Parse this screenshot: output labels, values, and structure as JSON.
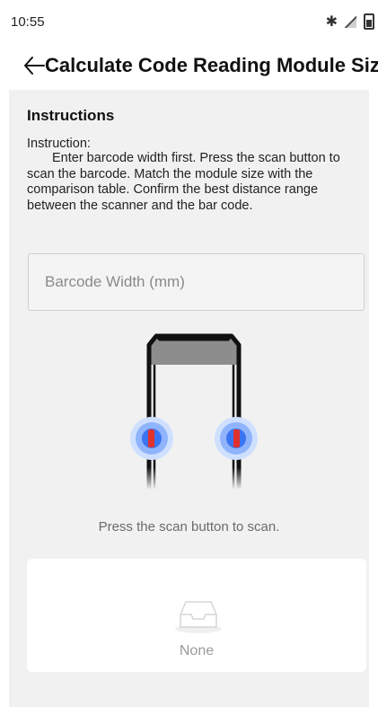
{
  "status_bar": {
    "time": "10:55",
    "icons": [
      "bluetooth-icon",
      "signal-icon",
      "battery-icon"
    ]
  },
  "header": {
    "back_icon": "back-arrow-icon",
    "title": "Calculate Code Reading Module Size"
  },
  "instructions": {
    "heading": "Instructions",
    "label": "Instruction:",
    "body": "Enter barcode width first. Press the scan button to scan the barcode. Match the module size with the comparison table. Confirm the best distance range between the scanner and the bar code."
  },
  "barcode_width_input": {
    "value": "",
    "placeholder": "Barcode Width (mm)"
  },
  "illustration": {
    "name": "device-scan-buttons-illustration",
    "accent_blue": "#4f86f7",
    "button_red": "#e0322c"
  },
  "scan_hint": "Press the scan button to scan.",
  "result": {
    "empty_icon": "empty-tray-icon",
    "empty_text": "None"
  },
  "colors": {
    "background": "#f1f1f1",
    "card": "#ffffff"
  }
}
